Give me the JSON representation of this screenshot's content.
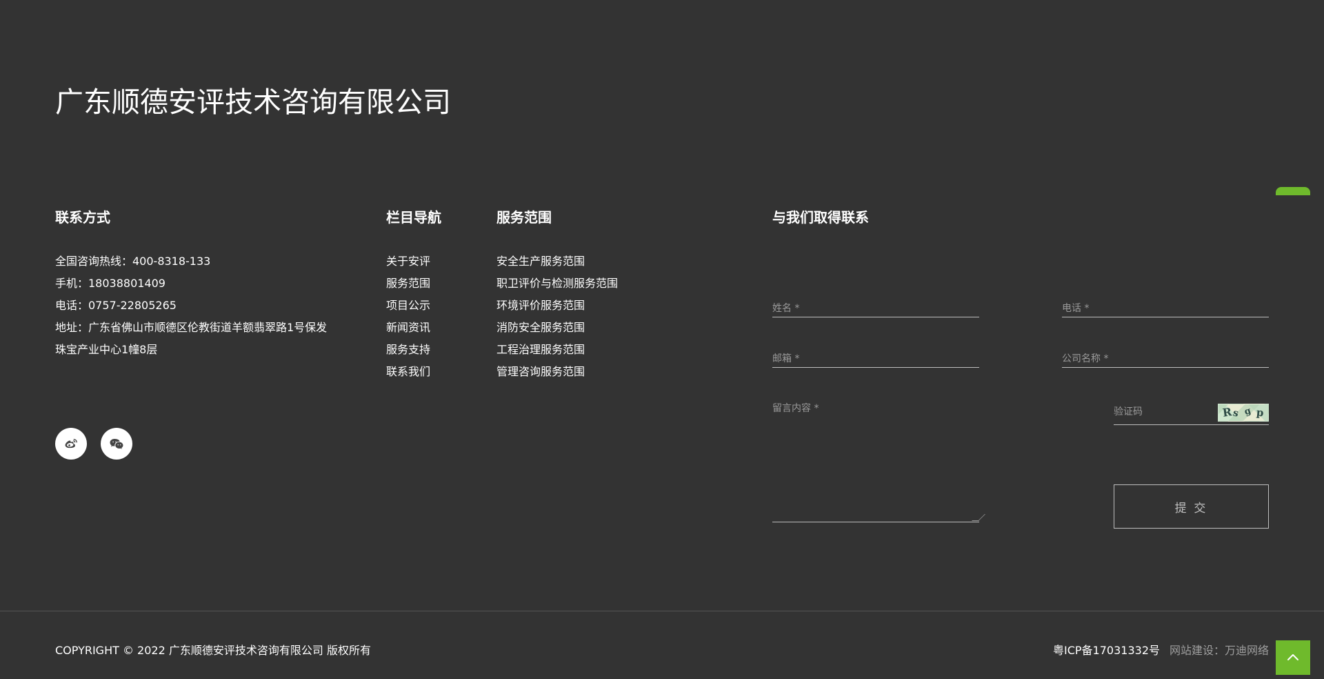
{
  "header": {
    "company_name": "广东顺德安评技术咨询有限公司"
  },
  "contact": {
    "title": "联系方式",
    "lines": [
      "全国咨询热线：400-8318-133",
      "手机：18038801409",
      "电话：0757-22805265",
      "地址：广东省佛山市顺德区伦教街道羊额翡翠路1号保发",
      "珠宝产业中心1幢8层"
    ]
  },
  "nav": {
    "title": "栏目导航",
    "items": [
      "关于安评",
      "服务范围",
      "项目公示",
      "新闻资讯",
      "服务支持",
      "联系我们"
    ]
  },
  "services": {
    "title": "服务范围",
    "items": [
      "安全生产服务范围",
      "职卫评价与检测服务范围",
      "环境评价服务范围",
      "消防安全服务范围",
      "工程治理服务范围",
      "管理咨询服务范围"
    ]
  },
  "form": {
    "title": "与我们取得联系",
    "name_label": "姓名 *",
    "phone_label": "电话 *",
    "email_label": "邮箱 *",
    "company_label": "公司名称 *",
    "message_label": "留言内容 *",
    "captcha_label": "验证码",
    "captcha_text": [
      "R",
      "s",
      "g",
      "p"
    ],
    "submit_label": "提 交"
  },
  "social": {
    "weibo_icon": "weibo-icon",
    "wechat_icon": "wechat-icon"
  },
  "footer": {
    "copyright": "COPYRIGHT © 2022 广东顺德安评技术咨询有限公司 版权所有",
    "icp": "粤ICP备17031332号",
    "builder": "网站建设：万迪网络"
  },
  "colors": {
    "background": "#333333",
    "accent": "#6fba2c",
    "line": "#bfbfbf",
    "muted_text": "#9a9a9a"
  }
}
